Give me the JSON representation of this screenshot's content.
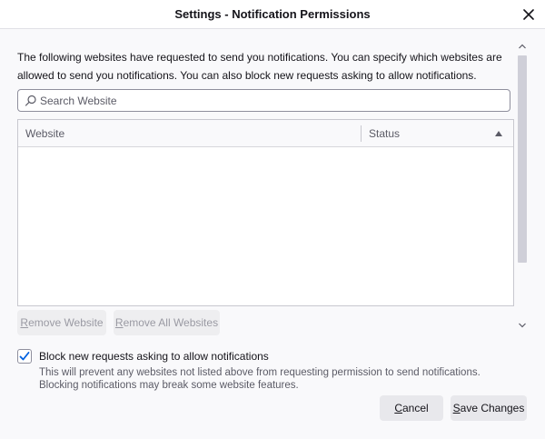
{
  "window": {
    "title": "Settings - Notification Permissions"
  },
  "intro_text": "The following websites have requested to send you notifications. You can specify which websites are allowed to send you notifications. You can also block new requests asking to allow notifications.",
  "search": {
    "placeholder": "Search Website",
    "value": ""
  },
  "table": {
    "columns": [
      "Website",
      "Status"
    ],
    "rows": []
  },
  "buttons": {
    "remove_website": "Remove Website",
    "remove_all_websites": "Remove All Websites",
    "cancel": "Cancel",
    "save_changes": "Save Changes"
  },
  "block_requests": {
    "checked": true,
    "label": "Block new requests asking to allow notifications",
    "description": "This will prevent any websites not listed above from requesting permission to send notifications. Blocking notifications may break some website features."
  },
  "icons": {
    "close": "close-icon",
    "search": "search-icon",
    "sort": "sort-ascending-icon",
    "check": "checkmark-icon"
  },
  "colors": {
    "accent": "#0061e0",
    "text": "#15141a",
    "muted_text": "#5b5b66"
  }
}
